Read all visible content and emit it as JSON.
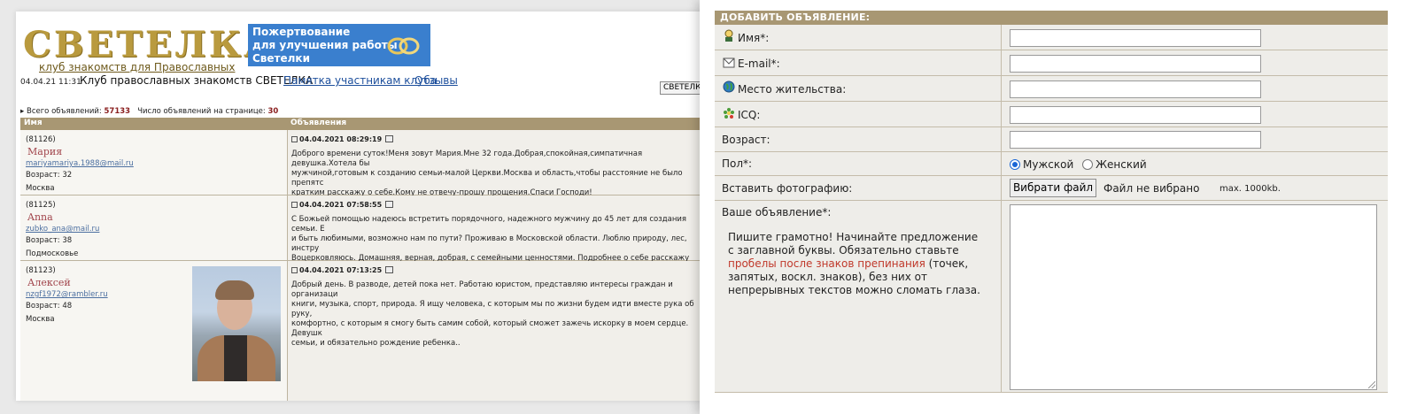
{
  "left_page": {
    "logo": {
      "title": "СВЕТЕЛКА",
      "subtitle": "клуб знакомств для Православных"
    },
    "donate_banner": {
      "line1": "Пожертвование",
      "line2": "для улучшения работы",
      "line3": "Светелки"
    },
    "header": {
      "datetime": "04.04.21 11:31",
      "site_title": "Клуб православных знакомств СВЕТЕЛКА",
      "link_rules": "Памятка участникам клуба",
      "link_reviews": "Отзывы",
      "search_button": "СВЕТЕЛКА"
    },
    "totals": {
      "total_label": "Всего объявлений:",
      "total_value": "57133",
      "per_page_label": "Число объявлений на странице:",
      "per_page_value": "30"
    },
    "list_columns": {
      "name": "Имя",
      "ads": "Объявления"
    },
    "ads": [
      {
        "id": "(81126)",
        "name": "Мария",
        "email": "mariyamariya.1988@mail.ru",
        "age": "Возраст: 32",
        "city": "Москва",
        "datetime": "04.04.2021 08:29:19",
        "text": "Доброго времени суток!Меня зовут Мария.Мне 32 года.Добрая,спокойная,симпатичная девушка.Хотела бы\nмужчиной,готовым к созданию семьи-малой Церкви.Москва и область,чтобы расстояние не было препятс\nкратким расскажу о себе.Кому не отвечу-прошу прощения.Спаси Господи!"
      },
      {
        "id": "(81125)",
        "name": "Anna",
        "email": "zubko_ana@mail.ru",
        "age": "Возраст: 38",
        "city": "Подмосковье",
        "datetime": "04.04.2021 07:58:55",
        "text": "С Божьей помощью надеюсь встретить порядочного, надежного мужчину до 45 лет для создания семьи. Е\nи быть любимыми, возможно нам по пути? Проживаю в Московской области. Люблю природу, лес, инстру\nВоцерковляюсь. Домашняя, верная, добрая, с семейными ценностями. Подробнее о себе расскажу при об"
      },
      {
        "id": "(81123)",
        "name": "Алексей",
        "email": "nzgf1972@rambler.ru",
        "age": "Возраст: 48",
        "city": "Москва",
        "datetime": "04.04.2021 07:13:25",
        "text": "Добрый день. В разводе, детей пока нет. Работаю юристом, представляю интересы граждан и организаци\nкниги, музыка, спорт, природа. Я ищу человека, с которым мы по жизни будем идти вместе рука об руку,\nкомфортно, с которым я смогу быть самим собой, который сможет зажечь искорку в моем сердце. Девушк\nсемьи, и обязательно рождение ребенка.."
      }
    ]
  },
  "form": {
    "title": "ДОБАВИТЬ ОБЪЯВЛЕНИЕ:",
    "name_label": "Имя*:",
    "email_label": "E-mail*:",
    "location_label": "Место жительства:",
    "icq_label": "ICQ:",
    "age_label": "Возраст:",
    "gender_label": "Пол*:",
    "gender_male": "Мужской",
    "gender_female": "Женский",
    "gender_selected": "male",
    "photo_label": "Вставить фотографию:",
    "file_button": "Вибрати файл",
    "file_status": "Файл не вибрано",
    "file_max": "max. 1000kb.",
    "ad_label": "Ваше объявление*:",
    "hint_part1": "Пишите грамотно! Начинайте предложение с заглавной буквы. Обязательно ставьте ",
    "hint_red": "пробелы после знаков препинания",
    "hint_part2": " (точек, запятых, воскл. знаков), без них от непрерывных текстов можно сломать глаза."
  },
  "colors": {
    "header_bar": "#a89773",
    "logo_gold": "#b99a3e",
    "donate_blue": "#3a7fce",
    "name_red": "#a1444b",
    "hint_red": "#c0392b",
    "link_blue": "#1d4f9c"
  }
}
